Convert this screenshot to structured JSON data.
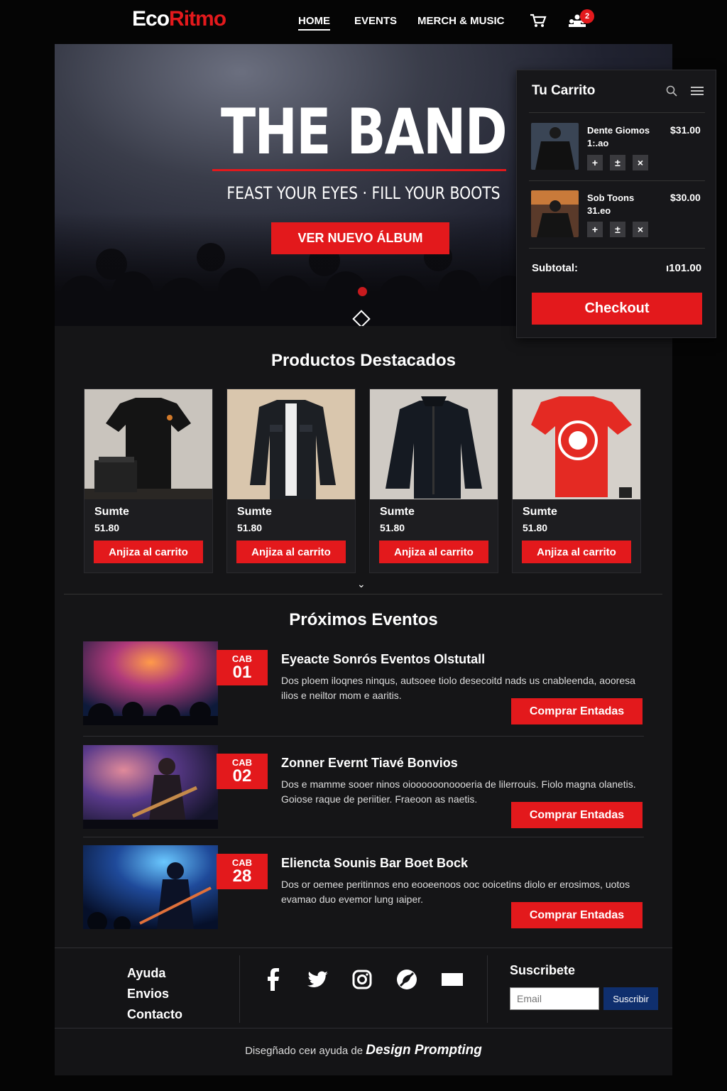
{
  "brand": {
    "part1": "Eco",
    "part2": "Ritmo"
  },
  "nav": {
    "home": "HOME",
    "events": "EVENTS",
    "merch": "MERCH & MUSIC",
    "user_badge": "2"
  },
  "hero": {
    "title": "THE BAND",
    "subtitle": "FEAST YOUR EYES · FILL YOUR BOOTS",
    "button": "VER NUEVO ÁLBUM"
  },
  "cart": {
    "title": "Tu Carrito",
    "items": [
      {
        "name": "Dente Giomos",
        "qty": "1:.ao",
        "price": "$31.00"
      },
      {
        "name": "Sob Toons",
        "qty": "31.eo",
        "price": "$30.00"
      }
    ],
    "subtotal_label": "Subtotal:",
    "subtotal_value": "ı101.00",
    "checkout": "Checkout"
  },
  "featured": {
    "title": "Productos Destacados",
    "products": [
      {
        "name": "Sumte",
        "price": "51.80",
        "button": "Anjiza al carrito"
      },
      {
        "name": "Sumte",
        "price": "51.80",
        "button": "Anjiza al carrito"
      },
      {
        "name": "Sumte",
        "price": "51.80",
        "button": "Anjiza al carrito"
      },
      {
        "name": "Sumte",
        "price": "51.80",
        "button": "Anjiza al carrito"
      }
    ]
  },
  "events": {
    "title": "Próximos Eventos",
    "items": [
      {
        "month": "CAB",
        "day": "01",
        "title": "Eyeacte Sonrós Eventos Olstutall",
        "desc": "Dos ploem iloqnes ninqus, autsoee tiolo desecoitd nads us cnableenda, aooresa ilios e neiltor mom e aaritis.",
        "button": "Comprar Entadas"
      },
      {
        "month": "CAB",
        "day": "02",
        "title": "Zonner Evernt Tiavé Bonvios",
        "desc": "Dos e mamme sooer ninos oioooooonoooeria de lilerrouis. Fiolo magna olanetis. Goiose raque de periitier. Fraeoon as naetis.",
        "button": "Comprar Entadas"
      },
      {
        "month": "CAB",
        "day": "28",
        "title": "Eliencta Sounis Bar Boet Bock",
        "desc": "Dos or oemee peritinnos eno eooeenoos ooc ooicetins diolo er erosimos, uotos evamao duo evemor lung ıaiper.",
        "button": "Comprar Entadas"
      }
    ]
  },
  "footer": {
    "links": [
      "Ayuda",
      "Envios",
      "Contacto"
    ],
    "subscribe_title": "Suscribete",
    "email_placeholder": "Email",
    "subscribe_button": "Suscribir",
    "credit_prefix": "Disegñado ceи ayuda de",
    "credit_brand": "Design Prompting"
  }
}
